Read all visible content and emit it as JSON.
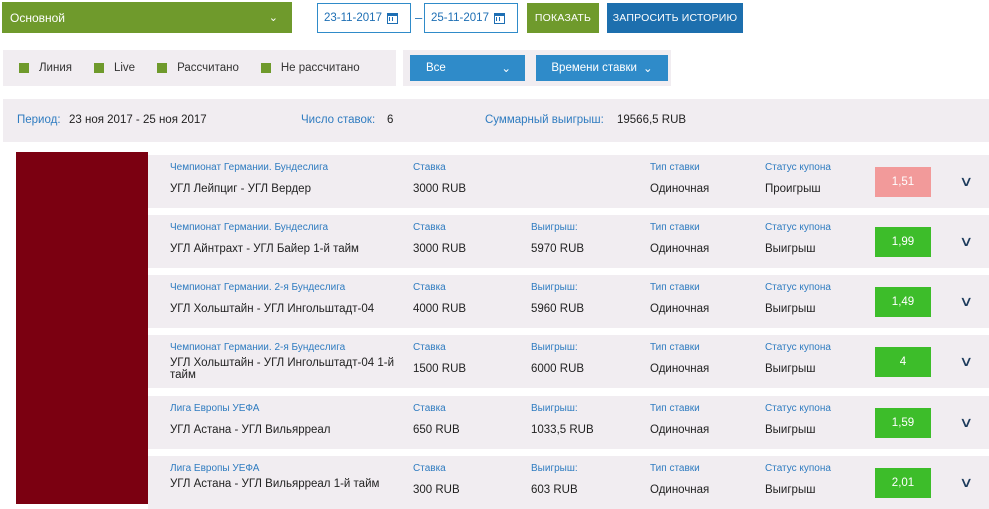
{
  "toolbar": {
    "account": "Основной",
    "date_from": "23-11-2017",
    "date_to": "25-11-2017",
    "dash": "–",
    "show_label": "ПОКАЗАТЬ",
    "history_label": "ЗАПРОСИТЬ ИСТОРИЮ"
  },
  "legend": {
    "items": [
      "Линия",
      "Live",
      "Рассчитано",
      "Не рассчитано"
    ],
    "color": "#6f9a2c"
  },
  "filters": {
    "type_value": "Все",
    "sort_value": "Времени ставки"
  },
  "summary": {
    "period_label": "Период:",
    "period_value": "23 ноя 2017 - 25 ноя 2017",
    "count_label": "Число ставок:",
    "count_value": "6",
    "total_label": "Суммарный выигрыш:",
    "total_value": "19566,5 RUB"
  },
  "labels": {
    "stake": "Ставка",
    "win": "Выигрыш:",
    "bet_type": "Тип ставки",
    "coupon_status": "Статус купона"
  },
  "bets": [
    {
      "league": "Чемпионат Германии. Бундеслига",
      "match": "УГЛ Лейпциг - УГЛ Вердер",
      "stake": "3000 RUB",
      "win": "",
      "type": "Одиночная",
      "status": "Проигрыш",
      "odds": "1,51",
      "result": "loss"
    },
    {
      "league": "Чемпионат Германии. Бундеслига",
      "match": "УГЛ Айнтрахт - УГЛ Байер 1-й тайм",
      "stake": "3000 RUB",
      "win": "5970 RUB",
      "type": "Одиночная",
      "status": "Выигрыш",
      "odds": "1,99",
      "result": "win"
    },
    {
      "league": "Чемпионат Германии. 2-я Бундеслига",
      "match": "УГЛ Хольштайн - УГЛ Ингольштадт-04",
      "stake": "4000 RUB",
      "win": "5960 RUB",
      "type": "Одиночная",
      "status": "Выигрыш",
      "odds": "1,49",
      "result": "win"
    },
    {
      "league": "Чемпионат Германии. 2-я Бундеслига",
      "match": "УГЛ Хольштайн - УГЛ Ингольштадт-04 1-й тайм",
      "stake": "1500 RUB",
      "win": "6000 RUB",
      "type": "Одиночная",
      "status": "Выигрыш",
      "odds": "4",
      "result": "win"
    },
    {
      "league": "Лига Европы УЕФА",
      "match": "УГЛ Астана - УГЛ Вильярреал",
      "stake": "650 RUB",
      "win": "1033,5 RUB",
      "type": "Одиночная",
      "status": "Выигрыш",
      "odds": "1,59",
      "result": "win"
    },
    {
      "league": "Лига Европы УЕФА",
      "match": "УГЛ Астана - УГЛ Вильярреал 1-й тайм",
      "stake": "300 RUB",
      "win": "603 RUB",
      "type": "Одиночная",
      "status": "Выигрыш",
      "odds": "2,01",
      "result": "win"
    }
  ]
}
